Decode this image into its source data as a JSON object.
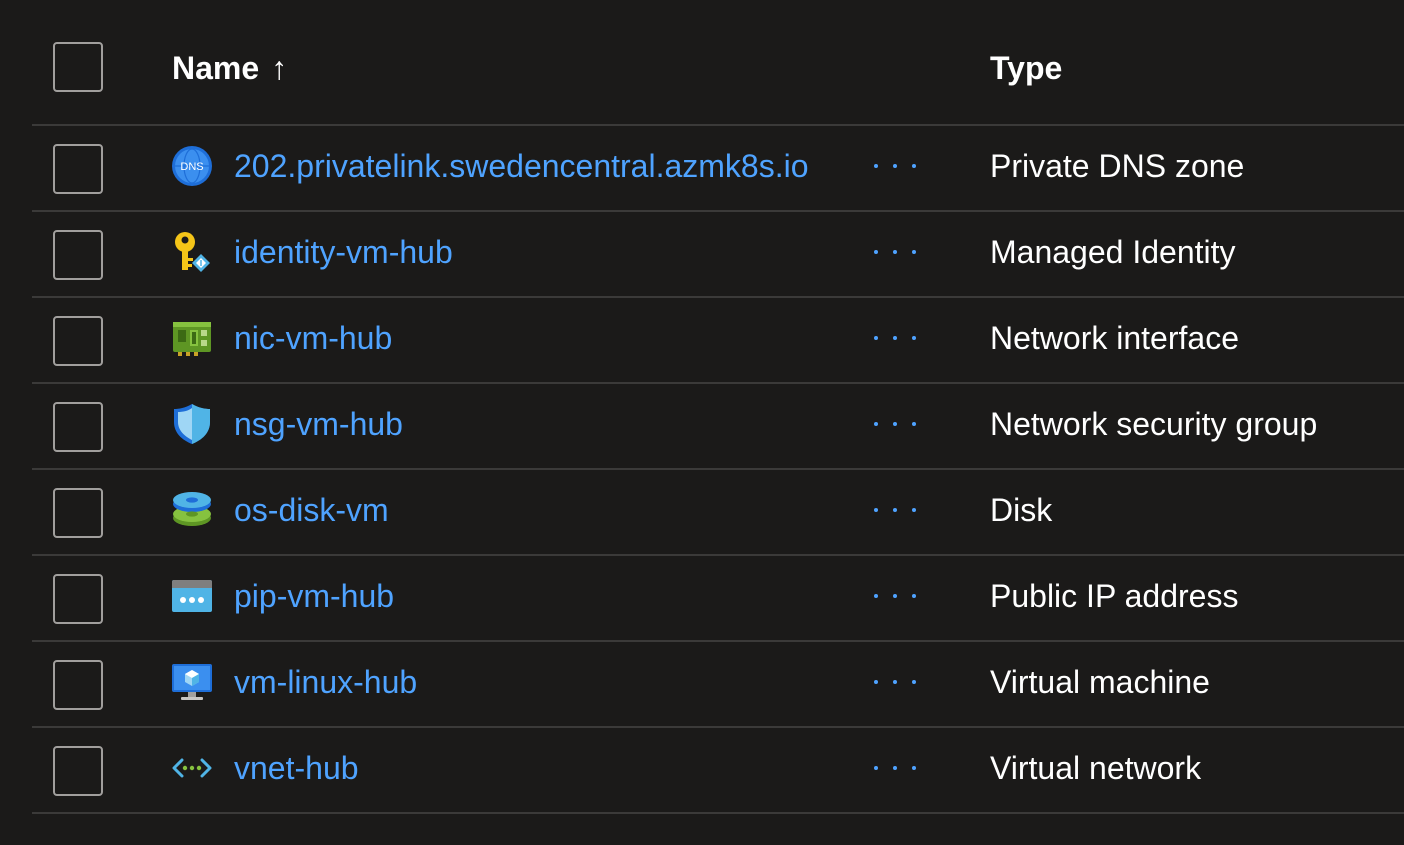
{
  "header": {
    "name_label": "Name",
    "sort_arrow": "↑",
    "type_label": "Type"
  },
  "rows": [
    {
      "name": "202.privatelink.swedencentral.azmk8s.io",
      "type": "Private DNS zone",
      "icon": "dns-zone-icon",
      "icon_text": "DNS"
    },
    {
      "name": "identity-vm-hub",
      "type": "Managed Identity",
      "icon": "managed-identity-icon"
    },
    {
      "name": "nic-vm-hub",
      "type": "Network interface",
      "icon": "network-interface-icon"
    },
    {
      "name": "nsg-vm-hub",
      "type": "Network security group",
      "icon": "shield-icon"
    },
    {
      "name": "os-disk-vm",
      "type": "Disk",
      "icon": "disk-icon"
    },
    {
      "name": "pip-vm-hub",
      "type": "Public IP address",
      "icon": "public-ip-icon"
    },
    {
      "name": "vm-linux-hub",
      "type": "Virtual machine",
      "icon": "virtual-machine-icon"
    },
    {
      "name": "vnet-hub",
      "type": "Virtual network",
      "icon": "virtual-network-icon"
    }
  ],
  "colors": {
    "background": "#1b1a19",
    "link": "#4fa3ff",
    "text": "#ffffff",
    "divider": "#3b3a39",
    "checkbox_border": "#a19f9d"
  }
}
